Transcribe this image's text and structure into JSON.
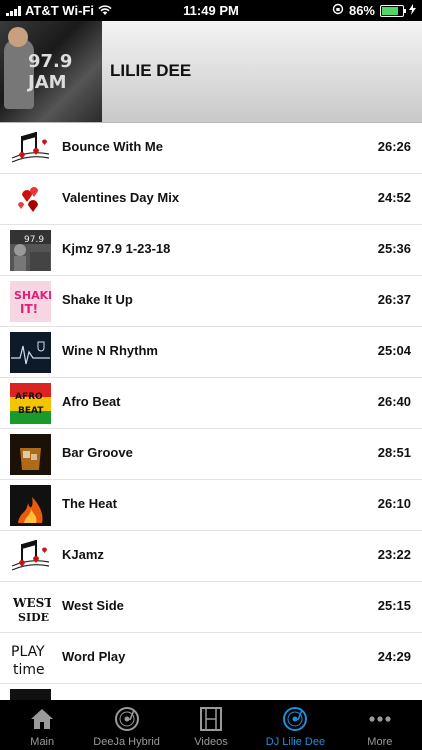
{
  "status": {
    "carrier": "AT&T Wi-Fi",
    "time": "11:49 PM",
    "battery": "86%",
    "battery_level": 0.86
  },
  "header": {
    "title": "LILIE DEE",
    "photo_text": "97.9 JAM"
  },
  "mixes": [
    {
      "title": "Bounce With Me",
      "duration": "26:26",
      "thumb": "music-notes-hearts"
    },
    {
      "title": "Valentines Day Mix",
      "duration": "24:52",
      "thumb": "hearts"
    },
    {
      "title": "Kjmz 97.9 1-23-18",
      "duration": "25:36",
      "thumb": "radio-photo"
    },
    {
      "title": "Shake It Up",
      "duration": "26:37",
      "thumb": "shake-it-logo"
    },
    {
      "title": "Wine N Rhythm",
      "duration": "25:04",
      "thumb": "heartbeat-wine"
    },
    {
      "title": "Afro Beat",
      "duration": "26:40",
      "thumb": "afro-beat-flag"
    },
    {
      "title": "Bar Groove",
      "duration": "28:51",
      "thumb": "whiskey-glass"
    },
    {
      "title": "The Heat",
      "duration": "26:10",
      "thumb": "flames"
    },
    {
      "title": "KJamz",
      "duration": "23:22",
      "thumb": "music-notes-hearts"
    },
    {
      "title": "West Side",
      "duration": "25:15",
      "thumb": "west-side-logo"
    },
    {
      "title": "Word Play",
      "duration": "24:29",
      "thumb": "play-time-text"
    }
  ],
  "tabs": [
    {
      "label": "Main",
      "icon": "home-icon",
      "active": false
    },
    {
      "label": "DeeJa Hybrid",
      "icon": "turntable-icon",
      "active": false
    },
    {
      "label": "Videos",
      "icon": "film-icon",
      "active": false
    },
    {
      "label": "DJ Lilie Dee",
      "icon": "turntable-icon",
      "active": true
    },
    {
      "label": "More",
      "icon": "more-dots-icon",
      "active": false
    }
  ],
  "colors": {
    "accent": "#1b8fe0",
    "battery_green": "#4cd964"
  }
}
